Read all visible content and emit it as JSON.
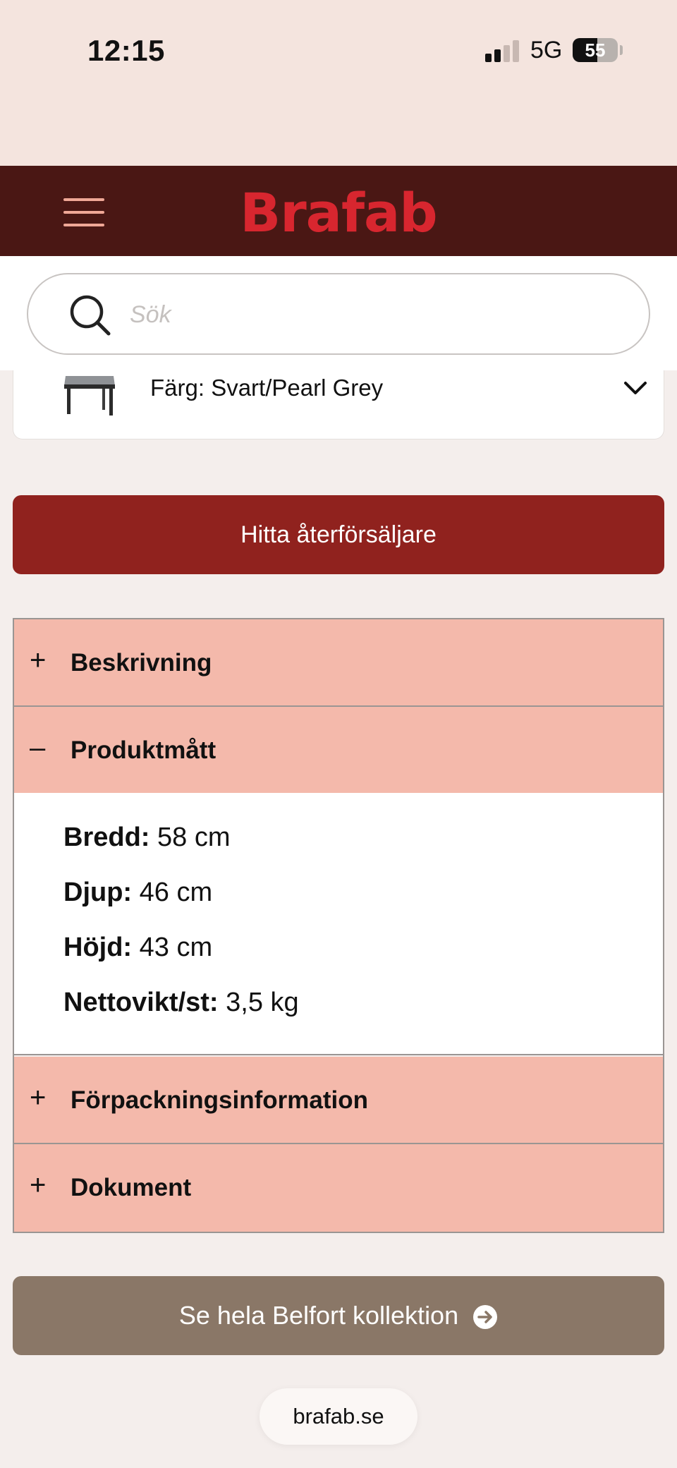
{
  "status_bar": {
    "time": "12:15",
    "network": "5G",
    "battery_level": "55"
  },
  "header": {
    "brand": "Brafab",
    "brand_color": "#d8262f",
    "background": "#4a1714",
    "menu_icon": "hamburger-menu-icon"
  },
  "search": {
    "placeholder": "Sök",
    "value": "",
    "icon": "search-icon"
  },
  "color_selector": {
    "label": "Färg: Svart/Pearl Grey",
    "expanded": false
  },
  "cta": {
    "reseller_label": "Hitta återförsäljare",
    "color": "#90221e"
  },
  "accordion": {
    "sections": [
      {
        "sign": "+",
        "title": "Beskrivning",
        "expanded": false
      },
      {
        "sign": "–",
        "title": "Produktmått",
        "expanded": true
      },
      {
        "sign": "+",
        "title": "Förpackningsinformation",
        "expanded": false
      },
      {
        "sign": "+",
        "title": "Dokument",
        "expanded": false
      }
    ],
    "header_color": "#f4b9ab"
  },
  "dimensions": [
    {
      "label": "Bredd:",
      "value": "58 cm"
    },
    {
      "label": "Djup:",
      "value": "46 cm"
    },
    {
      "label": "Höjd:",
      "value": "43 cm"
    },
    {
      "label": "Nettovikt/st:",
      "value": "3,5 kg"
    }
  ],
  "collection": {
    "label": "Se hela Belfort kollektion",
    "icon": "arrow-right-circle-icon",
    "color": "#8a7767"
  },
  "browser": {
    "url": "brafab.se"
  }
}
